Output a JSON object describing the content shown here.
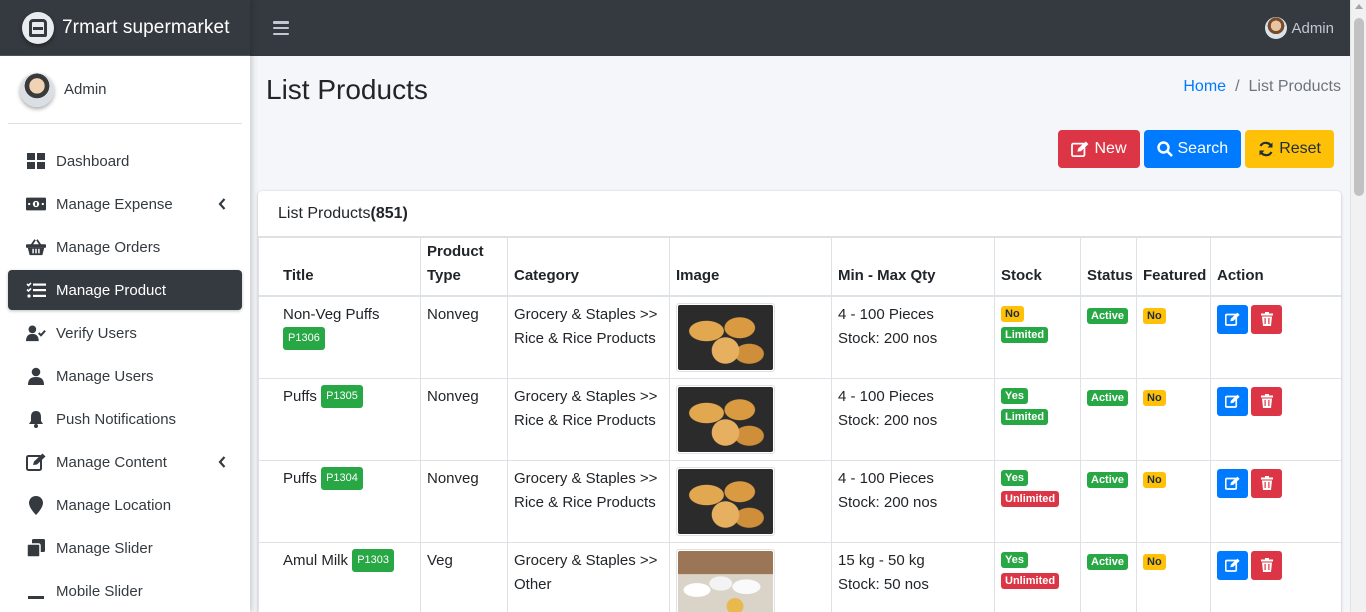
{
  "app": {
    "brand": "7rmart supermarket"
  },
  "sidebar": {
    "user_name": "Admin",
    "items": [
      {
        "label": "Dashboard",
        "icon": "dashboard-icon"
      },
      {
        "label": "Manage Expense",
        "icon": "money-icon"
      },
      {
        "label": "Manage Orders",
        "icon": "basket-icon"
      },
      {
        "label": "Manage Product",
        "icon": "list-check-icon"
      },
      {
        "label": "Verify Users",
        "icon": "user-check-icon"
      },
      {
        "label": "Manage Users",
        "icon": "user-icon"
      },
      {
        "label": "Push Notifications",
        "icon": "bell-icon"
      },
      {
        "label": "Manage Content",
        "icon": "edit-icon"
      },
      {
        "label": "Manage Location",
        "icon": "map-marker-icon"
      },
      {
        "label": "Manage Slider",
        "icon": "clone-icon"
      },
      {
        "label": "Mobile Slider",
        "icon": "minus-icon"
      }
    ]
  },
  "topbar": {
    "user_name": "Admin"
  },
  "page": {
    "title": "List Products",
    "breadcrumb": {
      "home": "Home",
      "separator": "/",
      "current": "List Products"
    },
    "buttons": {
      "new": "New",
      "search": "Search",
      "reset": "Reset"
    }
  },
  "card": {
    "title": "List Products",
    "count": "(851)"
  },
  "table": {
    "headers": {
      "title": "Title",
      "product_type": "Product Type",
      "category": "Category",
      "image": "Image",
      "qty": "Min - Max Qty",
      "stock": "Stock",
      "status": "Status",
      "featured": "Featured",
      "action": "Action"
    },
    "rows": [
      {
        "title": "Non-Veg Puffs",
        "code": "P1306",
        "type": "Nonveg",
        "category_1": "Grocery & Staples >>",
        "category_2": "Rice & Rice Products",
        "image": "puffs",
        "qty": "4 - 100 Pieces",
        "stock_text": "Stock: 200 nos",
        "stock_flag": "No",
        "stock_limit": "Limited",
        "status": "Active",
        "featured": "No"
      },
      {
        "title": "Puffs",
        "code": "P1305",
        "type": "Nonveg",
        "category_1": "Grocery & Staples >>",
        "category_2": "Rice & Rice Products",
        "image": "puffs",
        "qty": "4 - 100 Pieces",
        "stock_text": "Stock: 200 nos",
        "stock_flag": "Yes",
        "stock_limit": "Limited",
        "status": "Active",
        "featured": "No"
      },
      {
        "title": "Puffs",
        "code": "P1304",
        "type": "Nonveg",
        "category_1": "Grocery & Staples >>",
        "category_2": "Rice & Rice Products",
        "image": "puffs",
        "qty": "4 - 100 Pieces",
        "stock_text": "Stock: 200 nos",
        "stock_flag": "Yes",
        "stock_limit": "Unlimited",
        "status": "Active",
        "featured": "No"
      },
      {
        "title": "Amul Milk",
        "code": "P1303",
        "type": "Veg",
        "category_1": "Grocery & Staples >>",
        "category_2": "Other",
        "image": "milk",
        "qty": "15 kg - 50 kg",
        "stock_text": "Stock: 50 nos",
        "stock_flag": "Yes",
        "stock_limit": "Unlimited",
        "status": "Active",
        "featured": "No"
      }
    ]
  },
  "colors": {
    "dark": "#343a40",
    "primary": "#007bff",
    "danger": "#dc3545",
    "warning": "#ffc107",
    "success": "#28a745"
  }
}
